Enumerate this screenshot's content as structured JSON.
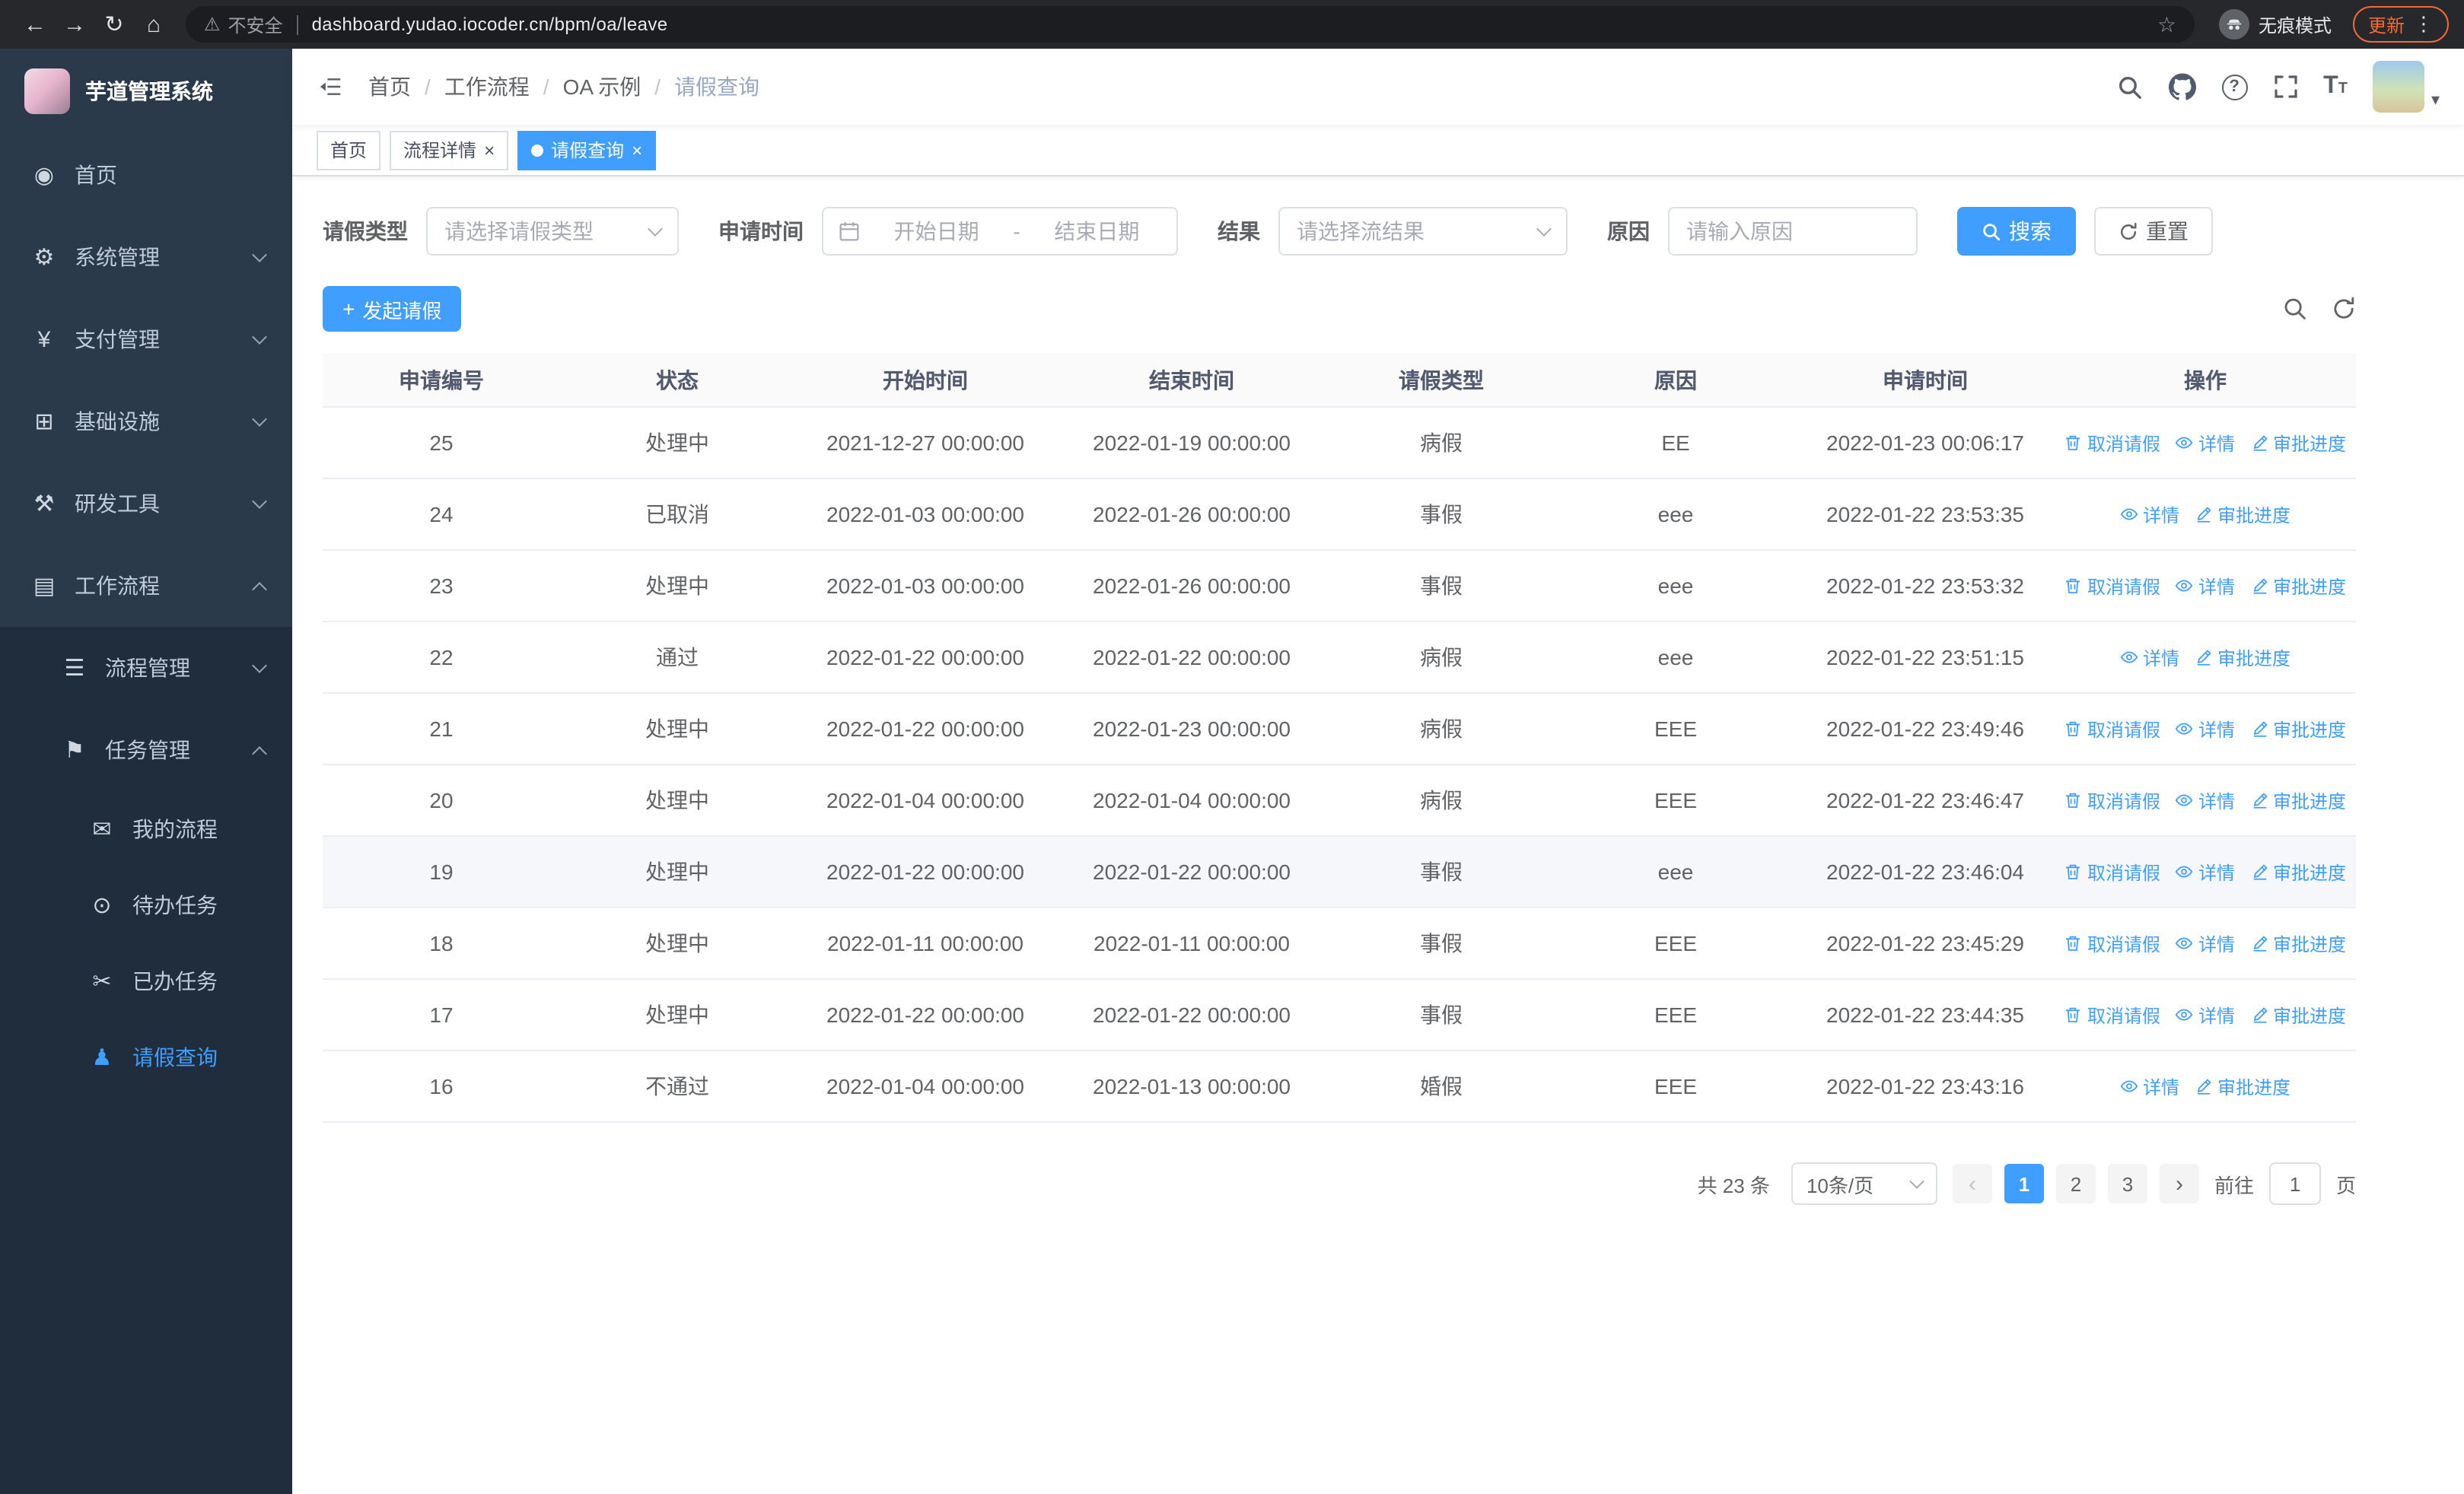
{
  "colors": {
    "primary": "#409eff",
    "sidebar_bg": "#2b3a4a",
    "submenu_bg": "#1f2d3d",
    "update_accent": "#f06a35",
    "table_border": "#ebeef5"
  },
  "browser": {
    "security_label": "不安全",
    "url": "dashboard.yudao.iocoder.cn/bpm/oa/leave",
    "incognito_label": "无痕模式",
    "update_label": "更新"
  },
  "icon_glyphs": {
    "dashboard-icon": "◉",
    "gear-icon": "⚙",
    "yen-icon": "¥",
    "monitor-icon": "⊞",
    "tools-icon": "⚒",
    "briefcase-icon": "▤",
    "list-icon": "☰",
    "flag-icon": "⚑",
    "message-icon": "✉",
    "eye-icon": "⊙",
    "scissors-icon": "✂",
    "user-icon": "♟"
  },
  "sidebar": {
    "logo_title": "芋道管理系统",
    "items": [
      {
        "key": "home",
        "label": "首页",
        "icon": "dashboard-icon",
        "level": 1
      },
      {
        "key": "system",
        "label": "系统管理",
        "icon": "gear-icon",
        "level": 1,
        "arrow": "down"
      },
      {
        "key": "payment",
        "label": "支付管理",
        "icon": "yen-icon",
        "level": 1,
        "arrow": "down"
      },
      {
        "key": "infra",
        "label": "基础设施",
        "icon": "monitor-icon",
        "level": 1,
        "arrow": "down"
      },
      {
        "key": "devtools",
        "label": "研发工具",
        "icon": "tools-icon",
        "level": 1,
        "arrow": "down"
      },
      {
        "key": "workflow",
        "label": "工作流程",
        "icon": "briefcase-icon",
        "level": 1,
        "arrow": "up"
      },
      {
        "key": "process-mgmt",
        "label": "流程管理",
        "icon": "list-icon",
        "level": 2,
        "arrow": "down"
      },
      {
        "key": "task-mgmt",
        "label": "任务管理",
        "icon": "flag-icon",
        "level": 2,
        "arrow": "up"
      },
      {
        "key": "my-process",
        "label": "我的流程",
        "icon": "message-icon",
        "level": 3
      },
      {
        "key": "todo-tasks",
        "label": "待办任务",
        "icon": "eye-icon",
        "level": 3
      },
      {
        "key": "done-tasks",
        "label": "已办任务",
        "icon": "scissors-icon",
        "level": 3
      },
      {
        "key": "leave-query",
        "label": "请假查询",
        "icon": "user-icon",
        "level": 3,
        "active": true
      }
    ]
  },
  "breadcrumb": [
    "首页",
    "工作流程",
    "OA 示例",
    "请假查询"
  ],
  "tabs": [
    {
      "key": "home",
      "label": "首页"
    },
    {
      "key": "process-detail",
      "label": "流程详情",
      "closable": true
    },
    {
      "key": "leave-query",
      "label": "请假查询",
      "closable": true,
      "active": true
    }
  ],
  "filters": {
    "leave_type": {
      "label": "请假类型",
      "placeholder": "请选择请假类型"
    },
    "apply_time": {
      "label": "申请时间",
      "start_placeholder": "开始日期",
      "separator": "-",
      "end_placeholder": "结束日期"
    },
    "result": {
      "label": "结果",
      "placeholder": "请选择流结果"
    },
    "reason": {
      "label": "原因",
      "placeholder": "请输入原因"
    },
    "search_label": "搜索",
    "reset_label": "重置"
  },
  "toolbar": {
    "create_label": "发起请假"
  },
  "table": {
    "columns": [
      "申请编号",
      "状态",
      "开始时间",
      "结束时间",
      "请假类型",
      "原因",
      "申请时间",
      "操作"
    ],
    "action_labels": {
      "cancel": "取消请假",
      "detail": "详情",
      "progress": "审批进度"
    },
    "rows": [
      {
        "id": "25",
        "status": "处理中",
        "start": "2021-12-27 00:00:00",
        "end": "2022-01-19 00:00:00",
        "type": "病假",
        "reason": "EE",
        "applied": "2022-01-23 00:06:17",
        "cancelable": true
      },
      {
        "id": "24",
        "status": "已取消",
        "start": "2022-01-03 00:00:00",
        "end": "2022-01-26 00:00:00",
        "type": "事假",
        "reason": "eee",
        "applied": "2022-01-22 23:53:35",
        "cancelable": false
      },
      {
        "id": "23",
        "status": "处理中",
        "start": "2022-01-03 00:00:00",
        "end": "2022-01-26 00:00:00",
        "type": "事假",
        "reason": "eee",
        "applied": "2022-01-22 23:53:32",
        "cancelable": true
      },
      {
        "id": "22",
        "status": "通过",
        "start": "2022-01-22 00:00:00",
        "end": "2022-01-22 00:00:00",
        "type": "病假",
        "reason": "eee",
        "applied": "2022-01-22 23:51:15",
        "cancelable": false
      },
      {
        "id": "21",
        "status": "处理中",
        "start": "2022-01-22 00:00:00",
        "end": "2022-01-23 00:00:00",
        "type": "病假",
        "reason": "EEE",
        "applied": "2022-01-22 23:49:46",
        "cancelable": true
      },
      {
        "id": "20",
        "status": "处理中",
        "start": "2022-01-04 00:00:00",
        "end": "2022-01-04 00:00:00",
        "type": "病假",
        "reason": "EEE",
        "applied": "2022-01-22 23:46:47",
        "cancelable": true
      },
      {
        "id": "19",
        "status": "处理中",
        "start": "2022-01-22 00:00:00",
        "end": "2022-01-22 00:00:00",
        "type": "事假",
        "reason": "eee",
        "applied": "2022-01-22 23:46:04",
        "cancelable": true,
        "highlighted": true
      },
      {
        "id": "18",
        "status": "处理中",
        "start": "2022-01-11 00:00:00",
        "end": "2022-01-11 00:00:00",
        "type": "事假",
        "reason": "EEE",
        "applied": "2022-01-22 23:45:29",
        "cancelable": true
      },
      {
        "id": "17",
        "status": "处理中",
        "start": "2022-01-22 00:00:00",
        "end": "2022-01-22 00:00:00",
        "type": "事假",
        "reason": "EEE",
        "applied": "2022-01-22 23:44:35",
        "cancelable": true
      },
      {
        "id": "16",
        "status": "不通过",
        "start": "2022-01-04 00:00:00",
        "end": "2022-01-13 00:00:00",
        "type": "婚假",
        "reason": "EEE",
        "applied": "2022-01-22 23:43:16",
        "cancelable": false
      }
    ]
  },
  "pagination": {
    "total_label": "共 23 条",
    "page_size": "10条/页",
    "pages": [
      "1",
      "2",
      "3"
    ],
    "active_page": "1",
    "prev_symbol": "‹",
    "next_symbol": "›",
    "goto_label": "前往",
    "goto_value": "1",
    "page_suffix": "页"
  }
}
